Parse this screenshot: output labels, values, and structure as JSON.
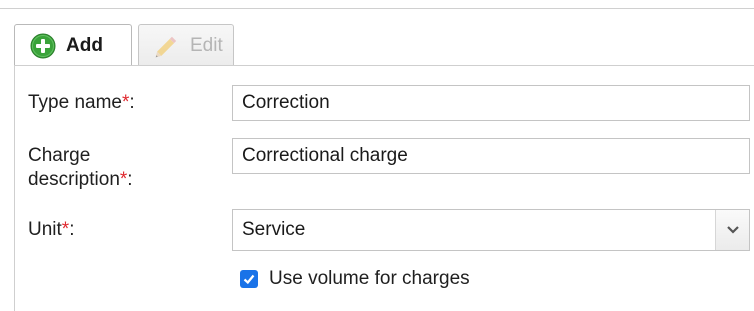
{
  "tabs": {
    "add": {
      "label": "Add",
      "icon": "plus-circle-icon",
      "active": true
    },
    "edit": {
      "label": "Edit",
      "icon": "pencil-icon",
      "active": false
    }
  },
  "form": {
    "type_name": {
      "label": "Type name",
      "required_mark": "*",
      "suffix": ":",
      "value": "Correction"
    },
    "charge_description": {
      "label_line1": "Charge",
      "label_line2": "description",
      "required_mark": "*",
      "suffix": ":",
      "value": "Correctional charge"
    },
    "unit": {
      "label": "Unit",
      "required_mark": "*",
      "suffix": ":",
      "selected": "Service"
    },
    "use_volume": {
      "label": "Use volume for charges",
      "checked": true
    }
  },
  "colors": {
    "required": "#e0282e",
    "checkbox": "#1a73e8",
    "add_icon": "#3aa33a"
  }
}
